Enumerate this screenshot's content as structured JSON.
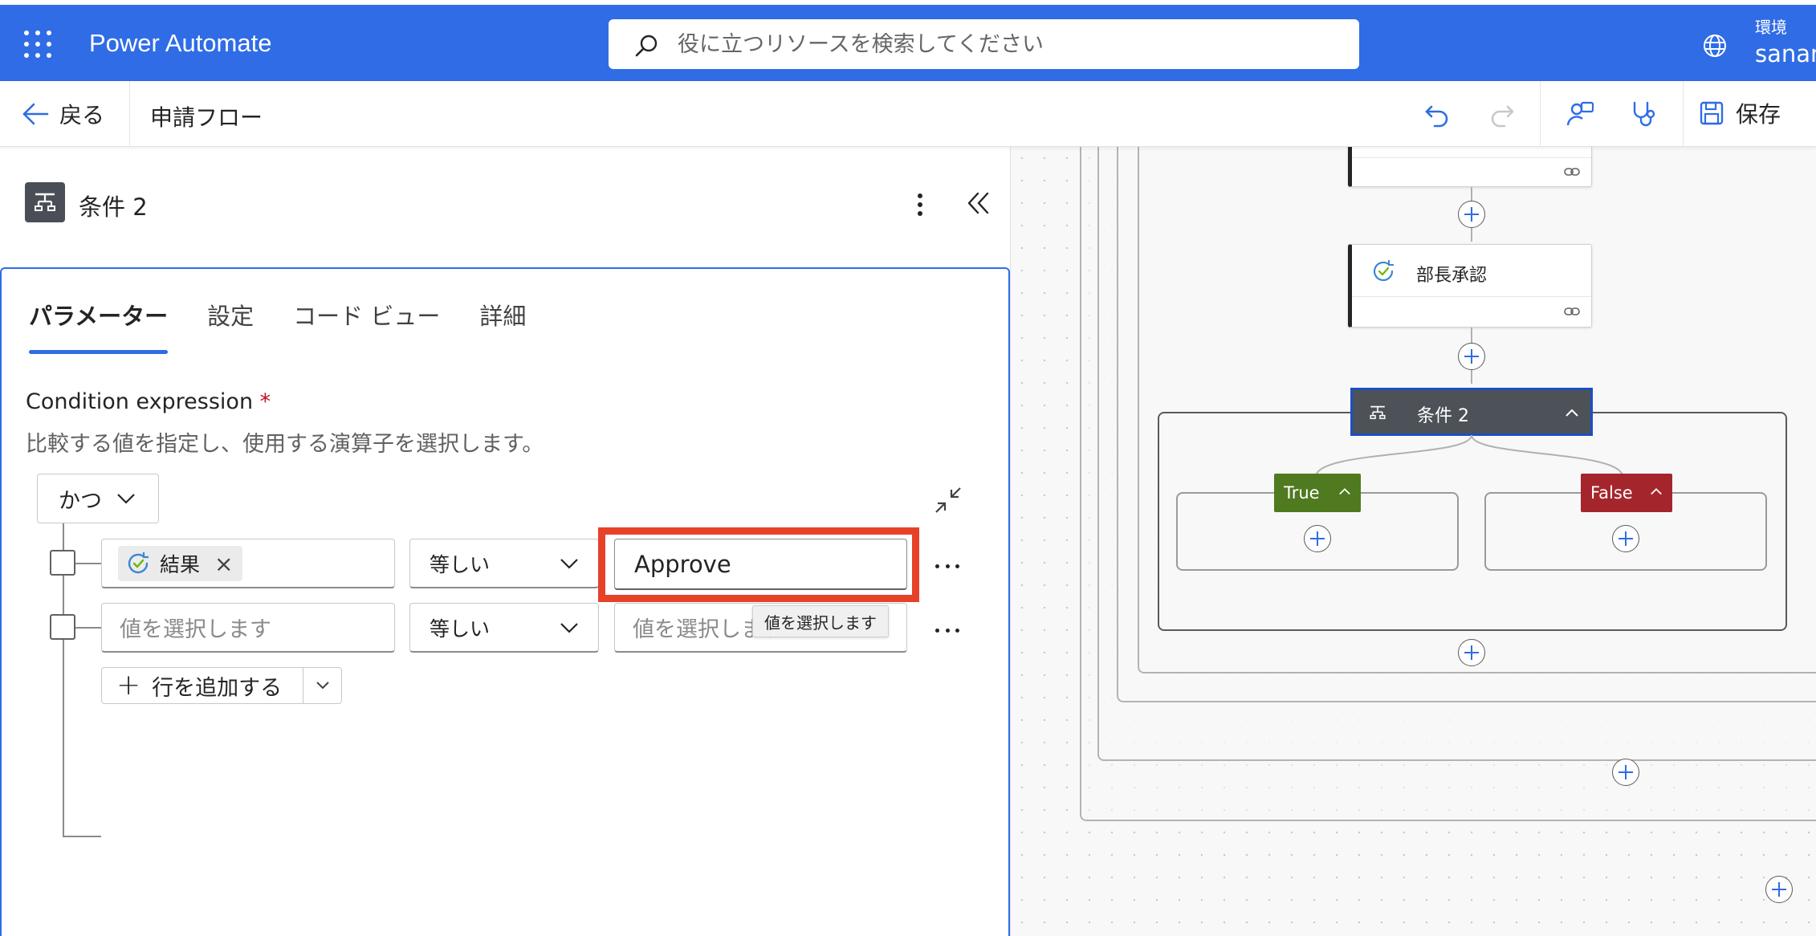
{
  "header": {
    "app_name": "Power Automate",
    "search_placeholder": "役に立つリソースを検索してください",
    "env_label": "環境",
    "env_name": "sanan"
  },
  "command_bar": {
    "back_label": "戻る",
    "flow_name": "申請フロー",
    "save_label": "保存"
  },
  "panel": {
    "title": "条件 2",
    "tabs": [
      {
        "label": "パラメーター",
        "active": true
      },
      {
        "label": "設定",
        "active": false
      },
      {
        "label": "コード ビュー",
        "active": false
      },
      {
        "label": "詳細",
        "active": false
      }
    ],
    "field_label": "Condition expression",
    "required_mark": "*",
    "field_description": "比較する値を指定し、使用する演算子を選択します。",
    "group_operator": "かつ",
    "rows": [
      {
        "left_token": "結果",
        "operator": "等しい",
        "right_value": "Approve"
      },
      {
        "left_placeholder": "値を選択します",
        "operator": "等しい",
        "right_placeholder": "値を選択します"
      }
    ],
    "tooltip": "値を選択します",
    "add_row_label": "行を追加する"
  },
  "canvas": {
    "cards": [
      {
        "title": "部長承認"
      }
    ],
    "condition_title": "条件 2",
    "true_label": "True",
    "false_label": "False"
  },
  "colors": {
    "brand_blue": "#2f6ce6",
    "highlight_red": "#e8412a",
    "true_green": "#4f7a1f",
    "false_red": "#a4262c",
    "condition_gray": "#4d5258"
  }
}
